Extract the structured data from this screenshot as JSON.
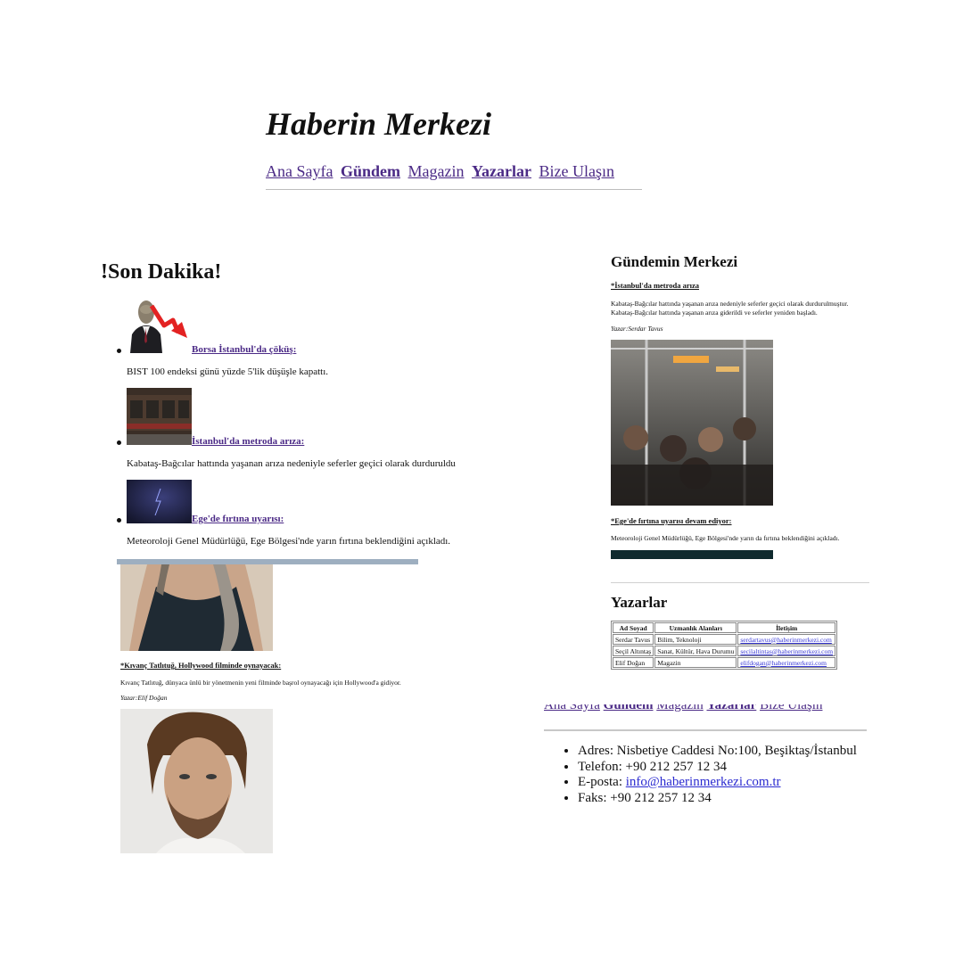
{
  "header": {
    "title": "Haberin Merkezi",
    "nav": [
      "Ana Sayfa",
      "Gündem",
      "Magazin",
      "Yazarlar",
      "Bize Ulaşın"
    ]
  },
  "breaking": {
    "title": "!Son Dakika!",
    "items": [
      {
        "link": "Borsa İstanbul'da çöküş:",
        "desc": "BIST 100 endeksi günü yüzde 5'lik düşüşle kapattı."
      },
      {
        "link": "İstanbul'da metroda arıza:",
        "desc": "Kabataş-Bağcılar hattında yaşanan arıza nedeniyle seferler geçici olarak durduruldu"
      },
      {
        "link": "Ege'de fırtına uyarısı:",
        "desc": "Meteoroloji Genel Müdürlüğü, Ege Bölgesi'nde yarın fırtına beklendiğini açıkladı."
      }
    ]
  },
  "magazine_news": {
    "link": "*Kıvanç Tatlıtuğ, Hollywood filminde oynayacak:",
    "desc": "Kıvanç Tatlıtuğ, dünyaca ünlü bir yönetmenin yeni filminde başrol oynayacağı için Hollywood'a gidiyor.",
    "author": "Yazar:Elif Doğan"
  },
  "gundem": {
    "title": "Gündemin Merkezi",
    "news1": {
      "link": "*İstanbul'da metroda arıza",
      "text1": "Kabataş-Bağcılar hattında yaşanan arıza nedeniyle seferler geçici olarak durdurulmuştur.",
      "text2": "Kabataş-Bağcılar hattında yaşanan arıza giderildi ve seferler yeniden başladı.",
      "author": "Yazar:Serdar Tavus"
    },
    "news2": {
      "link": "*Ege'de fırtına uyarısı devam ediyor:",
      "text": "Meteoroloji Genel Müdürlüğü, Ege Bölgesi'nde yarın da fırtına beklendiğini açıkladı."
    }
  },
  "writers": {
    "title": "Yazarlar",
    "headers": [
      "Ad Soyad",
      "Uzmanlık Alanları",
      "İletişim"
    ],
    "rows": [
      [
        "Serdar Tavus",
        "Bilim, Teknoloji",
        "serdartavus@haberinmerkezi.com"
      ],
      [
        "Seçil Altıntaş",
        "Sanat, Kültür, Hava Durumu",
        "secilaltintas@haberinmerkezi.com"
      ],
      [
        "Elif Doğan",
        "Magazin",
        "elifdogan@haberinmerkezi.com"
      ]
    ]
  },
  "contact": {
    "address": "Adres: Nisbetiye Caddesi No:100, Beşiktaş/İstanbul",
    "phone": "Telefon: +90 212 257 12 34",
    "email_label": "E-posta: ",
    "email": "info@haberinmerkezi.com.tr",
    "fax": "Faks: +90 212 257 12 34"
  }
}
